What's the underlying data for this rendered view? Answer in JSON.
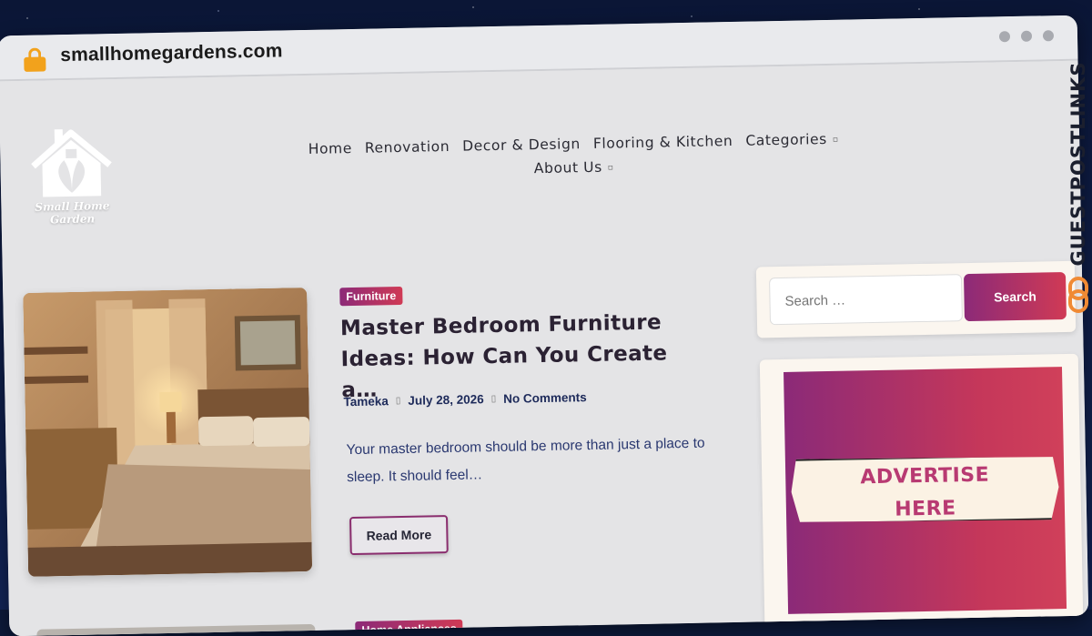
{
  "browser": {
    "url": "smallhomegardens.com"
  },
  "logo": {
    "text": "Small Home Garden"
  },
  "nav": {
    "row1": [
      "Home",
      "Renovation",
      "Decor & Design",
      "Flooring & Kitchen",
      "Categories"
    ],
    "row2": [
      "About Us"
    ]
  },
  "post": {
    "category": "Furniture",
    "title": "Master Bedroom Furniture Ideas: How Can You Create a…",
    "author": "Tameka",
    "date": "July 28, 2026",
    "comments": "No Comments",
    "excerpt": "Your master bedroom should be more than just a place to sleep. It should feel…",
    "read_more": "Read More"
  },
  "next_post": {
    "category": "Home Appliances"
  },
  "sidebar": {
    "search_placeholder": "Search …",
    "search_button": "Search",
    "ad_line1": "ADVERTISE",
    "ad_line2": "HERE"
  },
  "watermark": {
    "text": "GUESTPOSTLINKS"
  },
  "colors": {
    "accent_start": "#8c2a78",
    "accent_end": "#d03a55",
    "brand_text": "#2a3870"
  }
}
